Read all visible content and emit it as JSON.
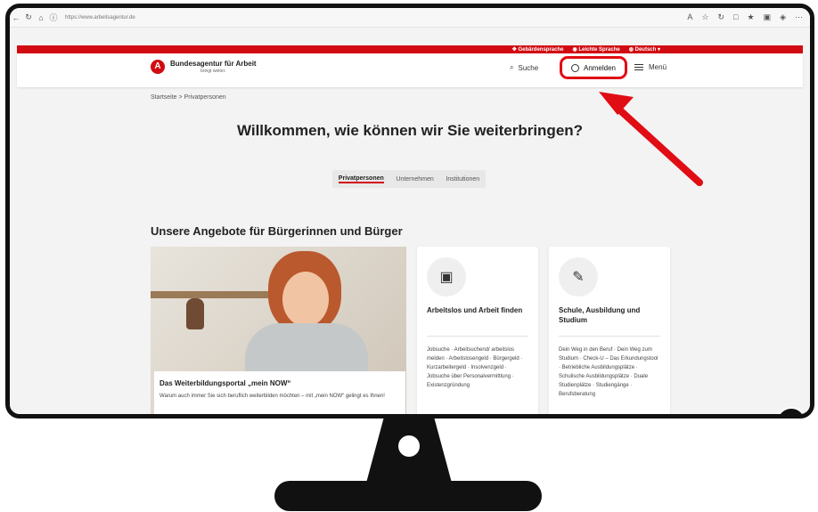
{
  "browser": {
    "url": "https://www.arbeitsagentur.de",
    "nav_icons": [
      "back-icon",
      "refresh-icon",
      "home-icon",
      "info-icon"
    ],
    "right_icons": [
      "reader-icon",
      "star-icon",
      "refresh-icon",
      "split-icon",
      "favorites-icon",
      "collections-icon",
      "extensions-icon",
      "more-icon"
    ]
  },
  "top_strip": {
    "items": [
      "Gebärdensprache",
      "Leichte Sprache",
      "Deutsch"
    ]
  },
  "header": {
    "brand": "Bundesagentur für Arbeit",
    "tagline": "bringt weiter.",
    "search_label": "Suche",
    "login_label": "Anmelden",
    "menu_label": "Menü"
  },
  "breadcrumb": {
    "items": [
      "Startseite",
      "Privatpersonen"
    ],
    "separator": ">"
  },
  "main": {
    "headline": "Willkommen, wie können wir Sie weiterbringen?",
    "tabs": [
      {
        "label": "Privatpersonen",
        "active": true
      },
      {
        "label": "Unternehmen",
        "active": false
      },
      {
        "label": "Institutionen",
        "active": false
      }
    ],
    "section_title": "Unsere Angebote für Bürgerinnen und Bürger"
  },
  "promo": {
    "title": "Das Weiterbildungsportal „mein NOW“",
    "text": "Warum auch immer Sie sich beruflich weiterbilden möchten – mit „mein NOW“ gelingt es Ihnen!"
  },
  "cards": [
    {
      "icon": "briefcase-icon",
      "title": "Arbeitslos und Arbeit finden",
      "text": "Jobsuche · Arbeitsuchend/ arbeitslos melden · Arbeitslosengeld · Bürgergeld · Kurzarbeitergeld · Insolvenzgeld · Jobsuche über Personalvermittlung · Existenzgründung"
    },
    {
      "icon": "document-edit-icon",
      "title": "Schule, Ausbildung und Studium",
      "text": "Dein Weg in den Beruf · Dein Weg zum Studium · Check-U – Das Erkundungstool · Betriebliche Ausbildungsplätze · Schulische Ausbildungsplätze · Duale Studienplätze · Studiengänge · Berufsberatung"
    }
  ],
  "colors": {
    "brand_red": "#d20a11",
    "highlight_red": "#e00d14"
  }
}
